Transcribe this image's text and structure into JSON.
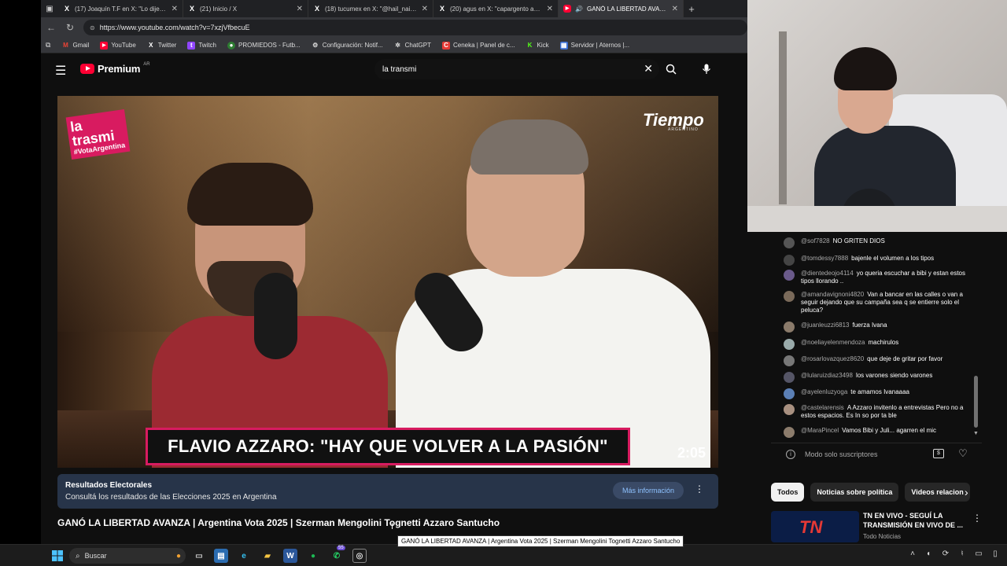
{
  "browser": {
    "tabs": [
      {
        "icon": "x-logo-icon",
        "title": "(17) Joaquín T.F en X: \"Lo dije. Ha",
        "active": false
      },
      {
        "icon": "x-logo-icon",
        "title": "(21) Inicio / X",
        "active": false
      },
      {
        "icon": "x-logo-icon",
        "title": "(18) tucumex en X: \"@hail_nai @j",
        "active": false
      },
      {
        "icon": "x-logo-icon",
        "title": "(20) agus en X: \"capargento ahor",
        "active": false
      },
      {
        "icon": "youtube-icon",
        "title": "GANÓ LA LIBERTAD AVANZA",
        "active": true
      }
    ],
    "url": "https://www.youtube.com/watch?v=7xzjVfbecuE",
    "bookmarks": [
      {
        "icon": "gmail-icon",
        "label": "Gmail"
      },
      {
        "icon": "youtube-icon",
        "label": "YouTube"
      },
      {
        "icon": "x-logo-icon",
        "label": "Twitter"
      },
      {
        "icon": "twitch-icon",
        "label": "Twitch"
      },
      {
        "icon": "promiedos-icon",
        "label": "PROMIEDOS - Futb..."
      },
      {
        "icon": "settings-icon",
        "label": "Configuración: Notif..."
      },
      {
        "icon": "chatgpt-icon",
        "label": "ChatGPT"
      },
      {
        "icon": "ceneka-icon",
        "label": "Ceneka | Panel de c..."
      },
      {
        "icon": "kick-icon",
        "label": "Kick"
      },
      {
        "icon": "aternos-icon",
        "label": "Servidor | Aternos |..."
      }
    ]
  },
  "youtube": {
    "logo_text": "Premium",
    "logo_region": "AR",
    "search_value": "la transmi"
  },
  "video": {
    "brand_left_1": "la",
    "brand_left_2": "trasmi",
    "brand_left_tag": "#VotaArgentina",
    "brand_right": "Tiempo",
    "brand_right_sub": "ARGENTINO",
    "lower_third": "FLAVIO AZZARO: \"HAY QUE VOLVER A LA PASIÓN\"",
    "timer": "2:05",
    "title": "GANÓ LA LIBERTAD AVANZA | Argentina Vota 2025 | Szerman Mengolini Tognetti Azzaro Santucho",
    "tooltip": "GANÓ LA LIBERTAD AVANZA | Argentina Vota 2025 | Szerman Mengolini Tognetti Azzaro Santucho"
  },
  "banner": {
    "title": "Resultados Electorales",
    "subtitle": "Consultá los resultados de las Elecciones 2025 en Argentina",
    "button": "Más información"
  },
  "chat": {
    "messages": [
      {
        "user": "@sof7828",
        "text": "NO GRITEN DIOS"
      },
      {
        "user": "@tomdessy7888",
        "text": "bajenle el volumen a los tipos"
      },
      {
        "user": "@dientedeojo4114",
        "text": "yo queria escuchar a bibi y estan estos tipos llorando .."
      },
      {
        "user": "@amandavignoni4820",
        "text": "Van a bancar en las calles o van a seguir dejando que su campaña sea q se entierre solo el peluca?"
      },
      {
        "user": "@juanleuzzi6813",
        "text": "fuerza Ivana"
      },
      {
        "user": "@noeliayelenmendoza",
        "text": "machirulos"
      },
      {
        "user": "@rosarlovazquez8620",
        "text": "que deje de gritar por favor"
      },
      {
        "user": "@lularuizdiaz3498",
        "text": "los varones siendo varones"
      },
      {
        "user": "@ayelenluzyoga",
        "text": "te amamos Ivanaaaa"
      },
      {
        "user": "@castelarensis",
        "text": "A Azzaro invitenlo a entrevistas Pero no a estos espacios. Es In so por ta ble"
      },
      {
        "user": "@MaraPincel",
        "text": "Vamos Bibi y Juli... agarren el mic"
      }
    ],
    "footer_mode": "Modo solo suscriptores"
  },
  "chips": [
    "Todos",
    "Noticias sobre política",
    "Videos relacion"
  ],
  "recommendation": {
    "thumb_text": "TN",
    "title": "TN EN VIVO - SEGUÍ LA TRANSMISIÓN EN VIVO DE ...",
    "channel": "Todo Noticias"
  },
  "taskbar": {
    "search_placeholder": "Buscar",
    "whatsapp_badge": "55"
  },
  "colors": {
    "yt_red": "#ff0033",
    "brand_pink": "#d81b60",
    "banner_bg": "#273449",
    "link_blue": "#8ec2ff"
  }
}
